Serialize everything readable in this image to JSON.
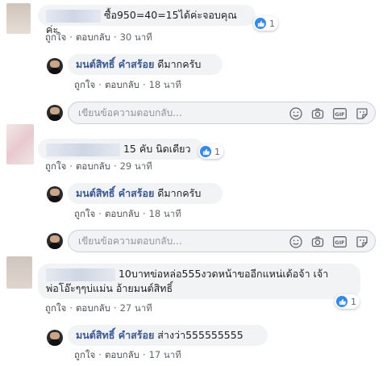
{
  "reply_placeholder": "เขียนข้อความตอบกลับ...",
  "action_labels": {
    "like": "ถูกใจ",
    "reply": "ตอบกลับ"
  },
  "threads": [
    {
      "comment_text": "ซื้อ950=40=15ได้ค่ะจอบคุณค่ะ",
      "like_count": "1",
      "time": "30 นาที",
      "reply": {
        "author": "มนต์สิทธิ์ คำสร้อย",
        "text": "ดีมากครับ",
        "time": "18 นาที"
      }
    },
    {
      "comment_text": "15 คับ นิดเดียว",
      "like_count": "1",
      "time": "29 นาที",
      "reply": {
        "author": "มนต์สิทธิ์ คำสร้อย",
        "text": "ดีมากครับ",
        "time": "18 นาที"
      }
    },
    {
      "comment_text_line1": "10บาทข่อหล่อ555งวดหน้าขออีกแหน่เด้อจ้า เจ้า",
      "comment_text_line2": "พ่อโอ๊ะๆๆบ่แม่น อ้ายมนต์สิทธิ์",
      "like_count": "1",
      "time": "27 นาที",
      "reply": {
        "author": "มนต์สิทธิ์ คำสร้อย",
        "text": "ส่างว่า555555555",
        "time": "17 นาที"
      }
    }
  ],
  "colors": {
    "link": "#385898",
    "bubble": "#f2f3f5",
    "like_blue": "#2e89ff",
    "meta": "#606770"
  },
  "icons": [
    "smiley-icon",
    "camera-icon",
    "gif-icon",
    "sticker-icon",
    "thumbs-up-icon"
  ]
}
